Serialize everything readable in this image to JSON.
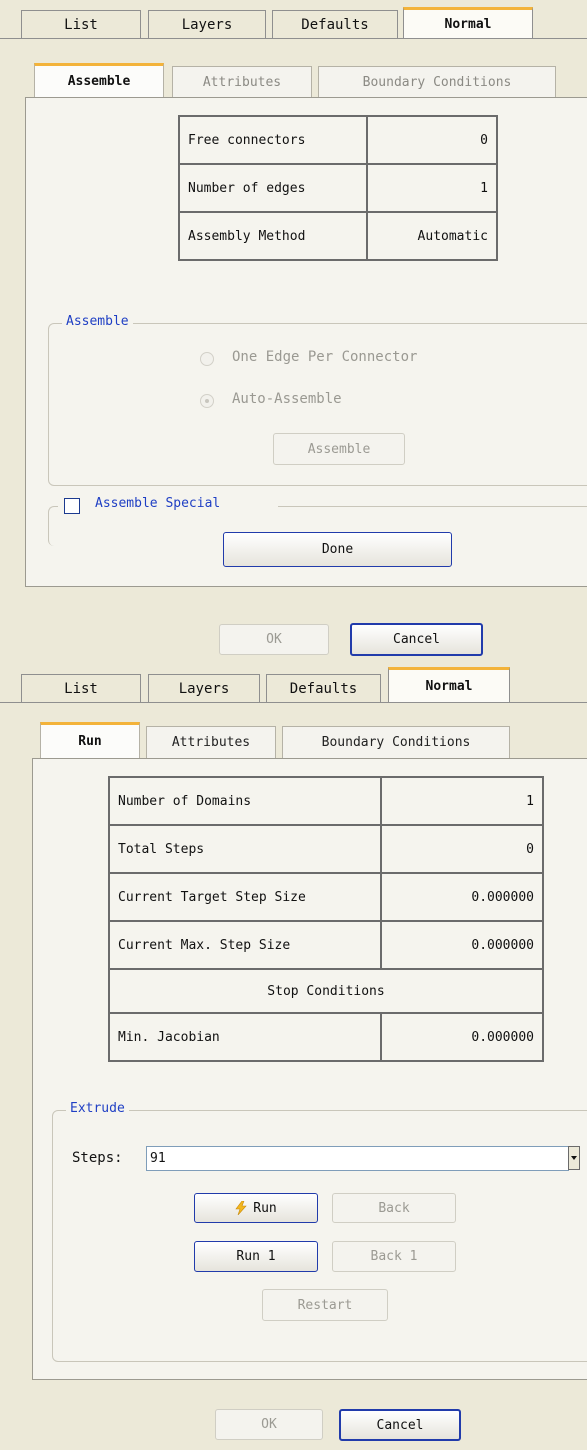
{
  "panel1": {
    "top_tabs": [
      "List",
      "Layers",
      "Defaults",
      "Normal"
    ],
    "inner_tabs": [
      "Assemble",
      "Attributes",
      "Boundary Conditions"
    ],
    "table": [
      {
        "label": "Free connectors",
        "value": "0"
      },
      {
        "label": "Number of edges",
        "value": "1"
      },
      {
        "label": "Assembly Method",
        "value": "Automatic"
      }
    ],
    "assemble_group": {
      "legend": "Assemble",
      "radio_one_edge": "One Edge Per Connector",
      "radio_auto": "Auto-Assemble",
      "assemble_button": "Assemble"
    },
    "assemble_special": {
      "label": "Assemble Special",
      "checked": false
    },
    "done_button": "Done",
    "ok_button": "OK",
    "cancel_button": "Cancel"
  },
  "panel2": {
    "top_tabs": [
      "List",
      "Layers",
      "Defaults",
      "Normal"
    ],
    "inner_tabs": [
      "Run",
      "Attributes",
      "Boundary Conditions"
    ],
    "table": [
      {
        "label": "Number of Domains",
        "value": "1"
      },
      {
        "label": "Total Steps",
        "value": "0"
      },
      {
        "label": "Current Target Step Size",
        "value": "0.000000"
      },
      {
        "label": "Current Max. Step Size",
        "value": "0.000000"
      },
      {
        "label": "Stop Conditions",
        "value": ""
      },
      {
        "label": "Min. Jacobian",
        "value": "0.000000"
      }
    ],
    "extrude_group": {
      "legend": "Extrude",
      "steps_label": "Steps:",
      "steps_value": "91",
      "run_button": "Run",
      "back_button": "Back",
      "run1_button": "Run 1",
      "back1_button": "Back 1",
      "restart_button": "Restart"
    },
    "ok_button": "OK",
    "cancel_button": "Cancel"
  },
  "colors": {
    "panel_bg": "#ece9d8",
    "active_tab_accent": "#f3b33a",
    "group_legend": "#1f3fc4",
    "primary_button_border": "#213bab"
  },
  "icons": {
    "run_button_icon": "lightning-icon",
    "dropdown_icon": "chevron-down-icon"
  }
}
